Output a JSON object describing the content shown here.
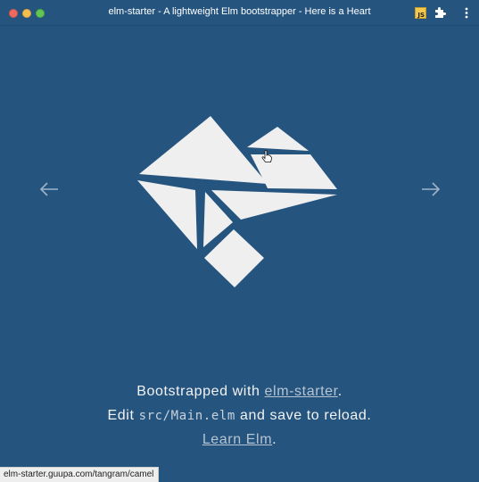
{
  "window": {
    "title": "elm-starter - A lightweight Elm bootstrapper - Here is a Heart"
  },
  "toolbar": {
    "extension_js_label": "JS",
    "icons": [
      "js-extension-icon",
      "puzzle-extension-icon",
      "more-menu-icon"
    ]
  },
  "colors": {
    "background": "#25557f",
    "shape": "#f0eff0",
    "text": "#f2f2f2",
    "link": "#b6c4d2"
  },
  "navigation": {
    "prev_icon": "arrow-left-icon",
    "next_icon": "arrow-right-icon"
  },
  "footer": {
    "line1_prefix": "Bootstrapped with",
    "line1_link": "elm-starter",
    "line1_suffix": ".",
    "line2_prefix": "Edit",
    "line2_code": "src/Main.elm",
    "line2_suffix": "and save to reload.",
    "line3_link": "Learn Elm",
    "line3_suffix": "."
  },
  "status": {
    "url": "elm-starter.guupa.com/tangram/camel"
  }
}
